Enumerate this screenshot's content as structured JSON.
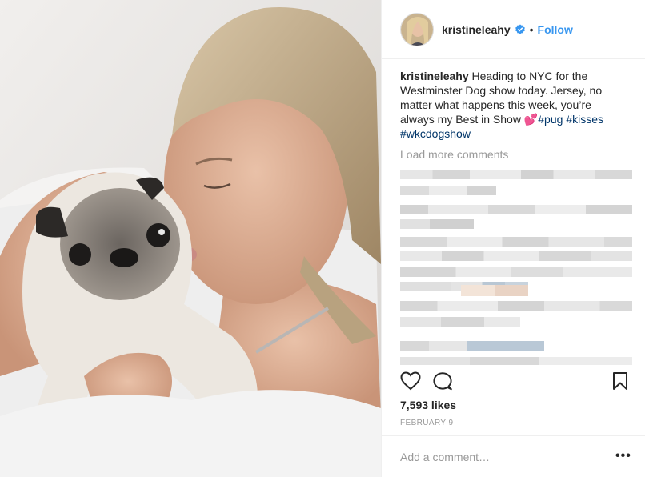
{
  "post": {
    "username": "kristineleahy",
    "follow_label": "Follow",
    "separator": "•",
    "caption": {
      "username": "kristineleahy",
      "text": " Heading to NYC for the Westminster Dog show today. Jersey, no matter what happens this week, you’re always my Best in Show 💕",
      "tags": [
        "#pug",
        "#kisses",
        "#wkcdogshow"
      ]
    },
    "load_more_label": "Load more comments",
    "likes": "7,593 likes",
    "date": "FEBRUARY 9",
    "comment_placeholder": "Add a comment…",
    "more_label": "•••"
  },
  "icons": {
    "verified": "verified-badge-icon",
    "like": "heart-icon",
    "comment": "comment-bubble-icon",
    "save": "bookmark-icon",
    "more": "more-options-icon"
  },
  "colors": {
    "follow": "#3897f0",
    "verified": "#3897f0",
    "hashtag": "#003569",
    "muted": "#999999",
    "text": "#262626",
    "divider": "#efefef"
  }
}
